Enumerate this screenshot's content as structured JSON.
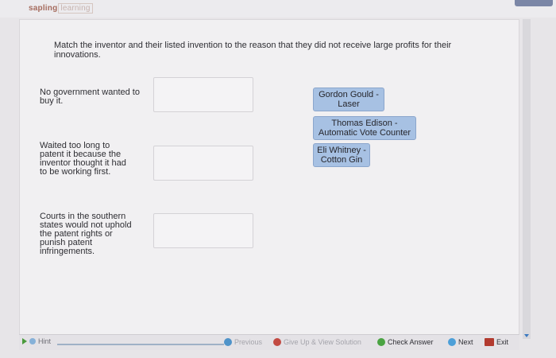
{
  "header": {
    "brand": "sapling",
    "brand_suffix": "learning"
  },
  "question": "Match the inventor and their listed invention to the reason that they did not receive large profits for their innovations.",
  "reasons": [
    "No government wanted to buy it.",
    "Waited too long to patent it because the inventor thought it had to be working first.",
    "Courts in the southern states would not uphold the patent rights or punish patent infringements."
  ],
  "choices": [
    "Gordon Gould - Laser",
    "Thomas Edison - Automatic Vote Counter",
    "Eli Whitney - Cotton Gin"
  ],
  "toolbar": {
    "hint": "Hint",
    "previous": "Previous",
    "give_up": "Give Up & View Solution",
    "check_answer": "Check Answer",
    "next": "Next",
    "exit": "Exit"
  }
}
